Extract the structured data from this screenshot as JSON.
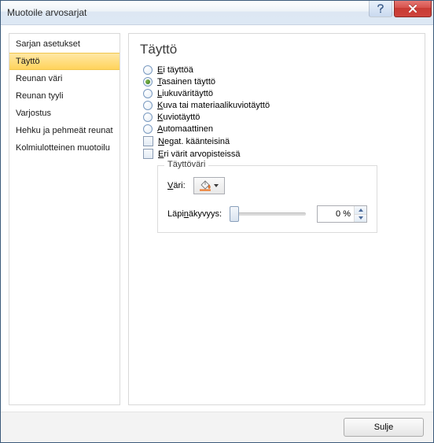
{
  "titlebar": {
    "title": "Muotoile arvosarjat"
  },
  "sidebar": {
    "items": [
      {
        "label": "Sarjan asetukset"
      },
      {
        "label": "Täyttö"
      },
      {
        "label": "Reunan väri"
      },
      {
        "label": "Reunan tyyli"
      },
      {
        "label": "Varjostus"
      },
      {
        "label": "Hehku ja pehmeät reunat"
      },
      {
        "label": "Kolmiulotteinen muotoilu"
      }
    ],
    "selected_index": 1
  },
  "main": {
    "heading": "Täyttö",
    "options": [
      {
        "type": "radio",
        "label_pre": "E",
        "label_post": "i täyttöä",
        "checked": false
      },
      {
        "type": "radio",
        "label_pre": "T",
        "label_post": "asainen täyttö",
        "checked": true
      },
      {
        "type": "radio",
        "label_pre": "L",
        "label_post": "iukuväritäyttö",
        "checked": false
      },
      {
        "type": "radio",
        "label_pre": "K",
        "label_post": "uva tai materiaalikuviotäyttö",
        "checked": false
      },
      {
        "type": "radio",
        "label_pre": "K",
        "label_post": "uviotäyttö",
        "checked": false
      },
      {
        "type": "radio",
        "label_pre": "A",
        "label_post": "utomaattinen",
        "checked": false
      },
      {
        "type": "checkbox",
        "label_pre": "N",
        "label_post": "egat. käänteisinä",
        "checked": false
      },
      {
        "type": "checkbox",
        "label_pre": "E",
        "label_post": "ri värit arvopisteissä",
        "checked": false
      }
    ],
    "groupbox": {
      "legend": "Täyttöväri",
      "color_label_pre": "V",
      "color_label_post": "äri:",
      "transparency_label_pre": "Läpi",
      "transparency_label_ul": "n",
      "transparency_label_post": "äkyvyys:",
      "transparency_value": "0 %",
      "fill_color": "#ed7d31"
    }
  },
  "footer": {
    "close_label": "Sulje"
  }
}
